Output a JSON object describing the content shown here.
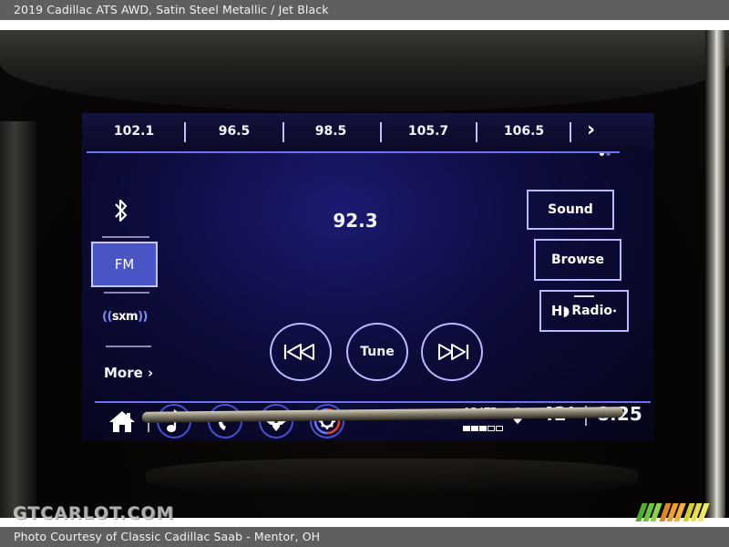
{
  "caption": {
    "title": "2019 Cadillac ATS AWD,  Satin Steel Metallic / Jet Black",
    "credit": "Photo Courtesy of Classic Cadillac Saab - Mentor, OH"
  },
  "watermark": "GTCARLOT.COM",
  "screen": {
    "presets": [
      "102.1",
      "96.5",
      "98.5",
      "105.7",
      "106.5"
    ],
    "presets_next_icon": "chevron-right-icon",
    "page_indicator": {
      "count": 2,
      "active": 0
    },
    "sources": {
      "bluetooth_icon": "bluetooth-icon",
      "fm_label": "FM",
      "sxm_label": "sxm",
      "more_label": "More",
      "more_icon": "chevron-right-icon"
    },
    "current_frequency": "92.3",
    "side_buttons": {
      "sound": "Sound",
      "browse": "Browse",
      "hd_radio": "Radio"
    },
    "controls": {
      "prev_icon": "seek-back-icon",
      "tune_label": "Tune",
      "next_icon": "seek-forward-icon"
    },
    "tray": {
      "home_icon": "home-icon",
      "apps": [
        "music-note-icon",
        "phone-icon",
        "navigation-pad-icon",
        "climate-settings-icon"
      ]
    },
    "status": {
      "network": "4G LTE",
      "signal_bars": {
        "filled": 3,
        "total": 5
      },
      "location_icon": "location-pin-icon",
      "temperature": "42°",
      "time": "8:25"
    }
  },
  "colors": {
    "accent": "#6e70f0",
    "fm_active": "#4a55c6",
    "caption_bg": "#5f5f5f"
  }
}
